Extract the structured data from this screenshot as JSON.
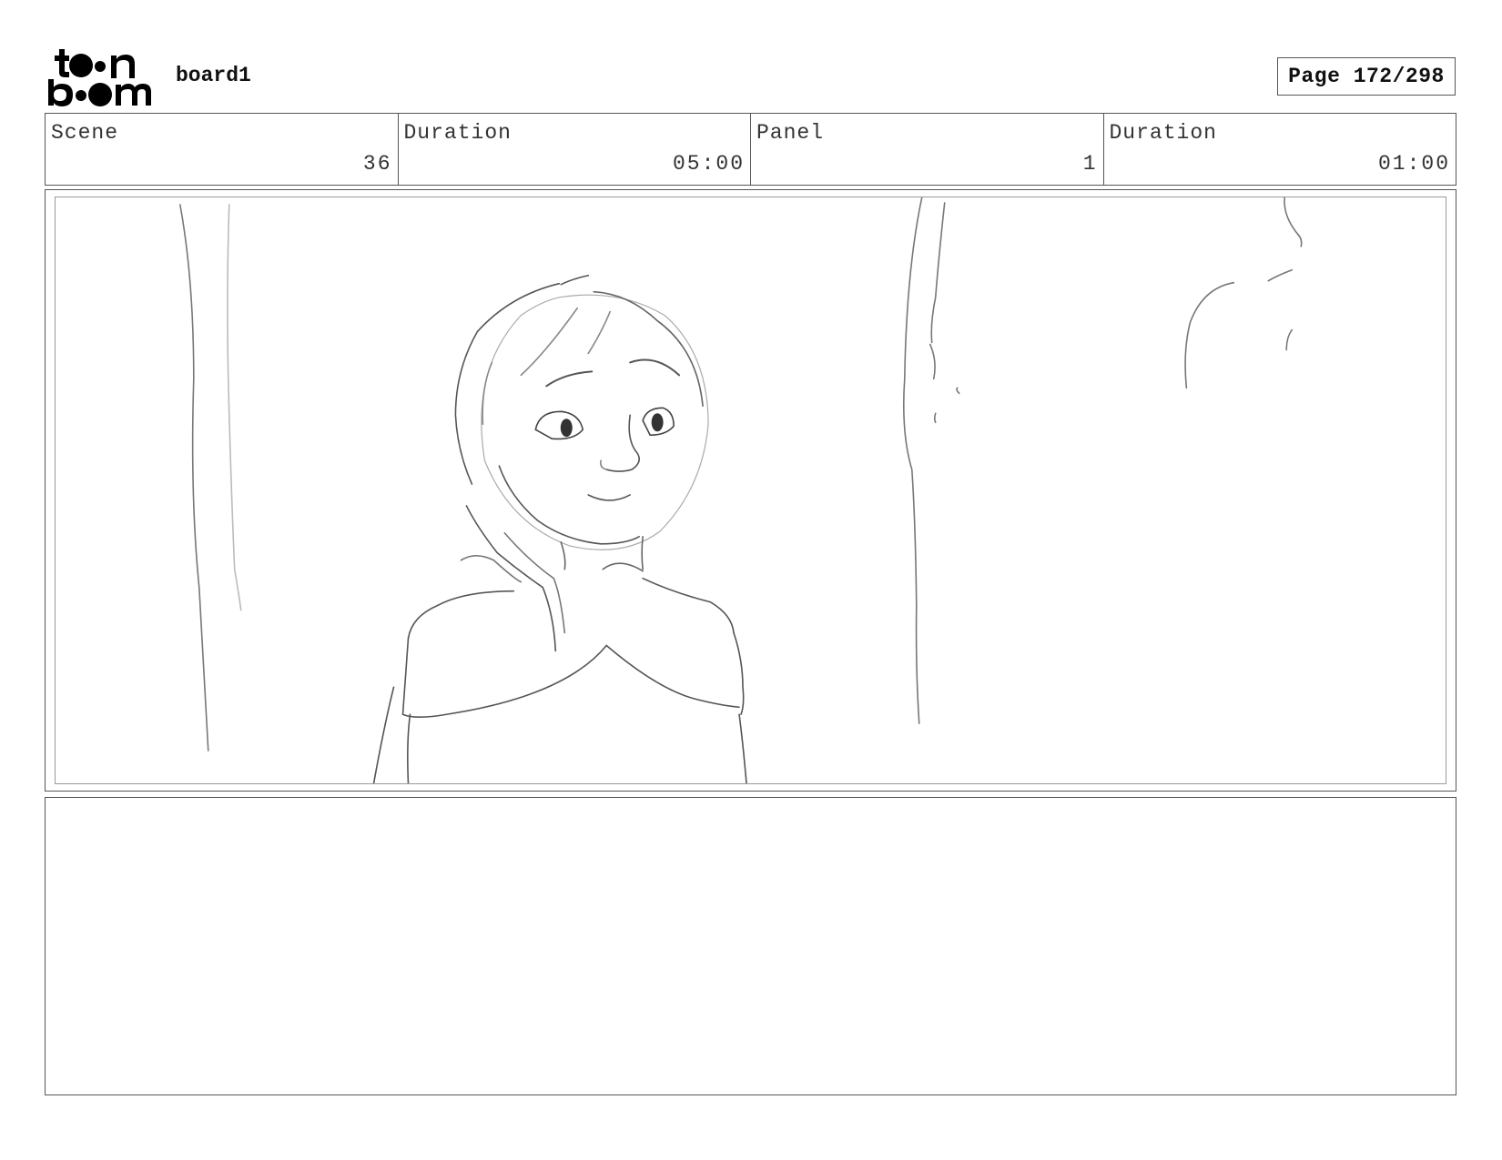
{
  "header": {
    "logo_lines": [
      "toon",
      "boom"
    ],
    "project_title": "board1",
    "page_label": "Page",
    "page_current": "172",
    "page_total": "298"
  },
  "info": [
    {
      "label": "Scene",
      "value": "36"
    },
    {
      "label": "Duration",
      "value": "05:00"
    },
    {
      "label": "Panel",
      "value": "1"
    },
    {
      "label": "Duration",
      "value": "01:00"
    }
  ],
  "notes": {
    "text": ""
  }
}
